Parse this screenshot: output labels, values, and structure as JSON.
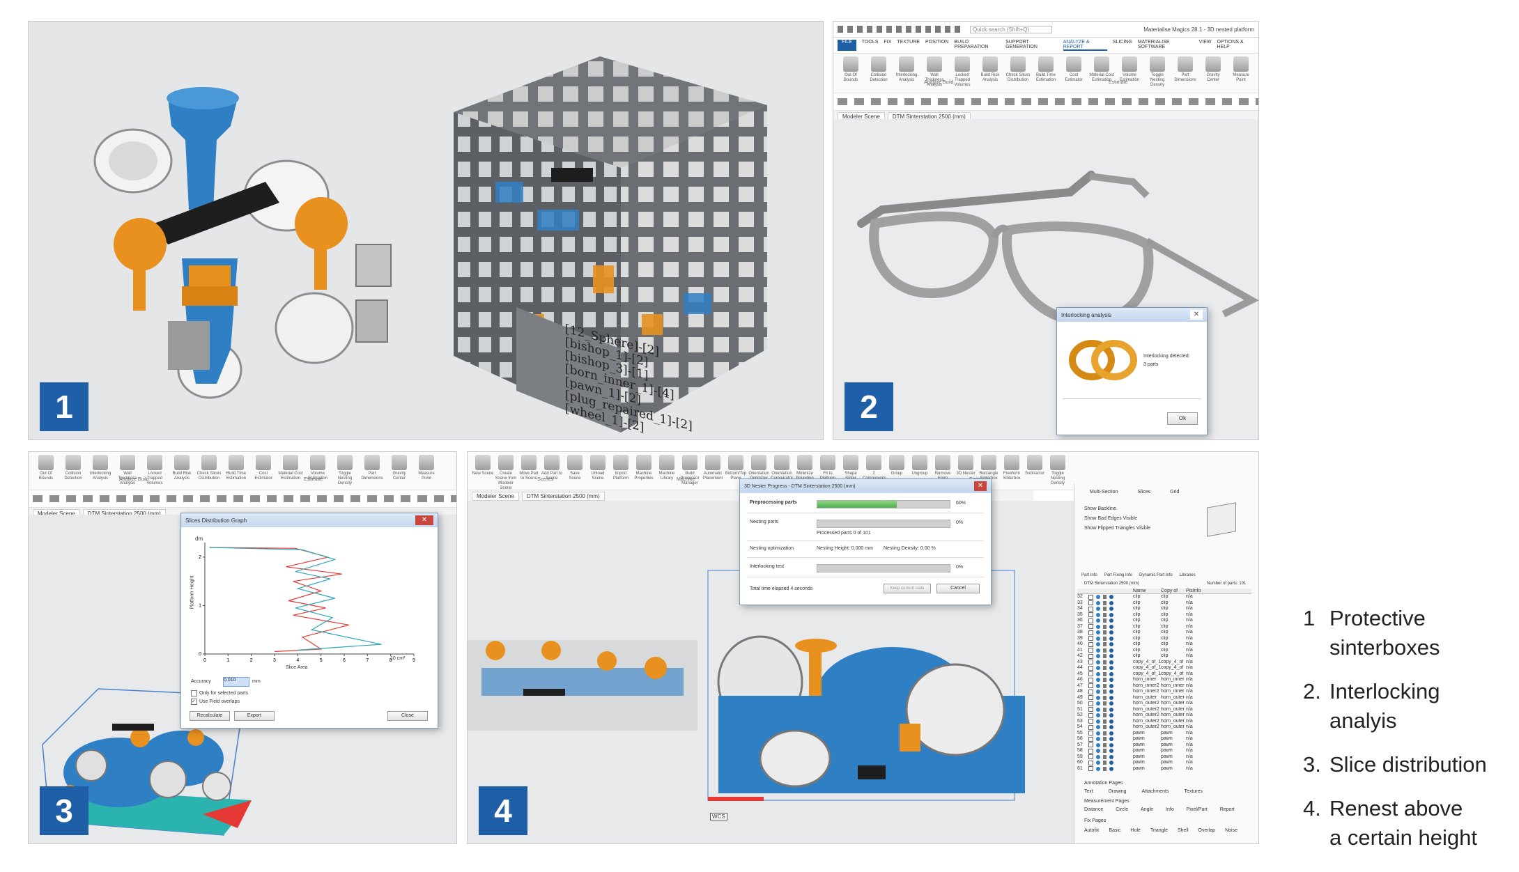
{
  "panels": [
    {
      "number": "1"
    },
    {
      "number": "2"
    },
    {
      "number": "3"
    },
    {
      "number": "4"
    }
  ],
  "legend": [
    {
      "num": "1",
      "line1": "Protective",
      "line2": "sinterboxes"
    },
    {
      "num": "2.",
      "line1": "Interlocking",
      "line2": "analyis"
    },
    {
      "num": "3.",
      "line1": "Slice distribution",
      "line2": ""
    },
    {
      "num": "4.",
      "line1": "Renest above",
      "line2": "a certain height"
    }
  ],
  "sinterbox": {
    "labels": [
      "[12_Sphere]-[2]",
      "[bishop_1]-[2]",
      "[bishop_3]-[1]",
      "[born_inner_1]-[4]",
      "[pawn_1]-[2]",
      "[plug_repaired_1]-[2]",
      "[wheel_1]-[2]"
    ]
  },
  "app2": {
    "title": "Materialise Magics 28.1 - 3D nested platform",
    "search_placeholder": "Quick search (Shift+Q)",
    "menu": [
      "FILE",
      "TOOLS",
      "FIX",
      "TEXTURE",
      "POSITION",
      "BUILD PREPARATION",
      "SUPPORT GENERATION",
      "ANALYZE & REPORT",
      "SLICING",
      "MATERIALISE SOFTWARE",
      "VIEW",
      "OPTIONS & HELP"
    ],
    "ribbon": [
      "Out Of Bounds",
      "Collision Detection",
      "Interlocking Analysis",
      "Wall Thickness Analysis",
      "Locked Trapped Volumes",
      "Build Risk Analysis",
      "Check Slices Distribution",
      "Build Time Estimation",
      "Cost Estimator",
      "Material Cost Estimation",
      "Volume Estimation",
      "Toggle Nesting Density",
      "Part Dimensions",
      "Gravity Center",
      "Measure Point"
    ],
    "group_analyze": "Analyze Build",
    "group_estimate": "Estimate",
    "tab1": "Modeler Scene",
    "tab2": "DTM Sinterstation 2500 (mm)",
    "dialog_title": "Interlocking analysis",
    "dialog_msg1": "Interlocking detected:",
    "dialog_msg2": "3 parts",
    "dialog_ok": "Ok"
  },
  "app3": {
    "ribbon": [
      "Out Of Bounds",
      "Collision Detection",
      "Interlocking Analysis",
      "Wall Thickness Analysis",
      "Locked Trapped Volumes",
      "Build Risk Analysis",
      "Check Slices Distribution",
      "Build Time Estimation",
      "Cost Estimator",
      "Material Cost Estimation",
      "Volume Estimation",
      "Toggle Nesting Density",
      "Part Dimensions",
      "Gravity Center",
      "Measure Point"
    ],
    "group_analyze": "Analyze Build",
    "group_estimate": "Estimate",
    "tab1": "Modeler Scene",
    "tab2": "DTM Sinterstation 2500 (mm)",
    "dialog_title": "Slices Distribution Graph",
    "y_unit": "dm",
    "y_label": "Platform Height",
    "x_label": "Slice Area",
    "x_unit": "10 cm²",
    "accuracy_label": "Accuracy",
    "accuracy_value": "0.010",
    "accuracy_unit": "mm",
    "check1": "Only for selected parts",
    "check2": "Use Field overlaps",
    "btn_recalc": "Recalculate",
    "btn_export": "Export",
    "btn_close": "Close"
  },
  "chart_data": {
    "type": "line",
    "xlabel": "Slice Area",
    "ylabel": "Platform Height",
    "xlim": [
      0,
      9
    ],
    "ylim": [
      0,
      2.3
    ],
    "x_ticks": [
      "0",
      "1",
      "2",
      "3",
      "4",
      "5",
      "6",
      "7",
      "8",
      "9"
    ],
    "y_ticks": [
      "0",
      "1",
      "2"
    ],
    "series": [
      {
        "color": "#e53935",
        "points": [
          [
            0.2,
            2.2
          ],
          [
            3.9,
            2.18
          ],
          [
            5.3,
            2.0
          ],
          [
            3.5,
            1.8
          ],
          [
            5.9,
            1.65
          ],
          [
            3.8,
            1.5
          ],
          [
            5.0,
            1.3
          ],
          [
            3.6,
            1.1
          ],
          [
            5.2,
            0.95
          ],
          [
            3.8,
            0.8
          ],
          [
            6.2,
            0.6
          ],
          [
            4.2,
            0.35
          ],
          [
            5.0,
            0.1
          ],
          [
            3.0,
            0.05
          ]
        ]
      },
      {
        "color": "#2aa7b8",
        "points": [
          [
            0.2,
            2.2
          ],
          [
            4.2,
            2.15
          ],
          [
            5.6,
            1.95
          ],
          [
            3.9,
            1.7
          ],
          [
            5.4,
            1.55
          ],
          [
            4.0,
            1.35
          ],
          [
            5.6,
            1.15
          ],
          [
            3.9,
            0.95
          ],
          [
            5.5,
            0.75
          ],
          [
            4.6,
            0.5
          ],
          [
            7.6,
            0.2
          ],
          [
            4.0,
            0.08
          ]
        ]
      }
    ]
  },
  "app4": {
    "ribbon": [
      "New Scene",
      "Create Scene from Modeler Scene",
      "Move Part to Scene",
      "Add Part to Scene",
      "Save Scene",
      "Unload Scene",
      "Import Platform",
      "Machine Properties",
      "Machine Library",
      "Build Processor Manager",
      "Automatic Placement",
      "Bottom/Top Plane",
      "Orientation Optimizer",
      "Orientation Comparator",
      "Minimize Bounding Box",
      "Fit to Platform",
      "Shape Sinter",
      "2 Components",
      "Group",
      "Ungroup",
      "Remove From Group",
      "3D Nester",
      "Rectangle Sinterbox",
      "Freeform Sinterbox",
      "Subtractor",
      "Toggle Nesting Density"
    ],
    "group_scenes": "Scenes",
    "group_machine": "Machine",
    "group_sinter": "Sinter",
    "tab1": "Modeler Scene",
    "tab2": "DTM Sinterstation 2500 (mm)",
    "dialog_title": "3D Nester Progress - DTM Sinterstation 2500 (mm)",
    "preprocessing_label": "Preprocessing parts",
    "preprocessing_pct": "60%",
    "preprocessing_value": 0.6,
    "nesting_label": "Nesting parts",
    "nesting_pct": "0%",
    "nesting_sub": "Processed parts 0 of 101",
    "opt_label": "Nesting optimization",
    "opt_height": "Nesting Height: 0.000 mm",
    "opt_density": "Nesting Density: 0.00 %",
    "interlock_label": "Interlocking test",
    "interlock_pct": "0%",
    "elapsed": "Total time elapsed 4 seconds",
    "btn_keep": "Keep current state",
    "btn_cancel": "Cancel",
    "axis_label": "WCS",
    "side_tabs": [
      "Multi-Section",
      "Slices",
      "Grid"
    ],
    "side_opts": [
      "Show Backline",
      "Show Bad Edges Visible",
      "Show Flipped Triangles Visible"
    ],
    "parts_header": [
      "Part Info",
      "Part Fixing Info",
      "Dynamic Part Info",
      "Libraries"
    ],
    "platform": "DTM Sinterstation 2500 (mm)",
    "num_parts": "Number of parts: 101",
    "columns": [
      "Name",
      "Copy of",
      "PisInfo"
    ],
    "rows": [
      {
        "id": "32",
        "name": "clip",
        "copy": "clip",
        "info": "n/a"
      },
      {
        "id": "33",
        "name": "clip",
        "copy": "clip",
        "info": "n/a"
      },
      {
        "id": "34",
        "name": "clip",
        "copy": "clip",
        "info": "n/a"
      },
      {
        "id": "35",
        "name": "clip",
        "copy": "clip",
        "info": "n/a"
      },
      {
        "id": "36",
        "name": "clip",
        "copy": "clip",
        "info": "n/a"
      },
      {
        "id": "37",
        "name": "clip",
        "copy": "clip",
        "info": "n/a"
      },
      {
        "id": "38",
        "name": "clip",
        "copy": "clip",
        "info": "n/a"
      },
      {
        "id": "39",
        "name": "clip",
        "copy": "clip",
        "info": "n/a"
      },
      {
        "id": "40",
        "name": "clip",
        "copy": "clip",
        "info": "n/a"
      },
      {
        "id": "41",
        "name": "clip",
        "copy": "clip",
        "info": "n/a"
      },
      {
        "id": "42",
        "name": "clip",
        "copy": "clip",
        "info": "n/a"
      },
      {
        "id": "43",
        "name": "copy_4_of_1",
        "copy": "copy_4_of",
        "info": "n/a"
      },
      {
        "id": "44",
        "name": "copy_4_of_1",
        "copy": "copy_4_of",
        "info": "n/a"
      },
      {
        "id": "45",
        "name": "copy_4_of_1",
        "copy": "copy_4_of",
        "info": "n/a"
      },
      {
        "id": "46",
        "name": "horn_inner",
        "copy": "horn_inner",
        "info": "n/a"
      },
      {
        "id": "47",
        "name": "horn_inner2",
        "copy": "horn_inner",
        "info": "n/a"
      },
      {
        "id": "48",
        "name": "horn_inner2",
        "copy": "horn_inner",
        "info": "n/a"
      },
      {
        "id": "49",
        "name": "horn_outer",
        "copy": "horn_outer",
        "info": "n/a"
      },
      {
        "id": "50",
        "name": "horn_outer2",
        "copy": "horn_outer",
        "info": "n/a"
      },
      {
        "id": "51",
        "name": "horn_outer2",
        "copy": "horn_outer",
        "info": "n/a"
      },
      {
        "id": "52",
        "name": "horn_outer2",
        "copy": "horn_outer",
        "info": "n/a"
      },
      {
        "id": "53",
        "name": "horn_outer2",
        "copy": "horn_outer",
        "info": "n/a"
      },
      {
        "id": "54",
        "name": "horn_outer2",
        "copy": "horn_outer",
        "info": "n/a"
      },
      {
        "id": "55",
        "name": "pawn",
        "copy": "pawn",
        "info": "n/a"
      },
      {
        "id": "56",
        "name": "pawn",
        "copy": "pawn",
        "info": "n/a"
      },
      {
        "id": "57",
        "name": "pawn",
        "copy": "pawn",
        "info": "n/a"
      },
      {
        "id": "58",
        "name": "pawn",
        "copy": "pawn",
        "info": "n/a"
      },
      {
        "id": "59",
        "name": "pawn",
        "copy": "pawn",
        "info": "n/a"
      },
      {
        "id": "60",
        "name": "pawn",
        "copy": "pawn",
        "info": "n/a"
      },
      {
        "id": "61",
        "name": "pawn",
        "copy": "pawn",
        "info": "n/a"
      }
    ],
    "annotation_pages": "Annotation Pages",
    "annotation_tabs": [
      "Text",
      "Drawing",
      "Attachments",
      "Textures"
    ],
    "measurement_pages": "Measurement Pages",
    "measurement_tabs": [
      "Distance",
      "Circle",
      "Angle",
      "Info",
      "Pixel/Part",
      "Report"
    ],
    "fix_pages": "Fix Pages",
    "fix_tabs": [
      "Autofix",
      "Basic",
      "Hole",
      "Triangle",
      "Shell",
      "Overlap",
      "Noise"
    ]
  },
  "colors": {
    "badge": "#1f5fa8",
    "part_blue": "#2f7fc4",
    "part_orange": "#e58f1f",
    "cage_gray": "#6b6f74"
  }
}
